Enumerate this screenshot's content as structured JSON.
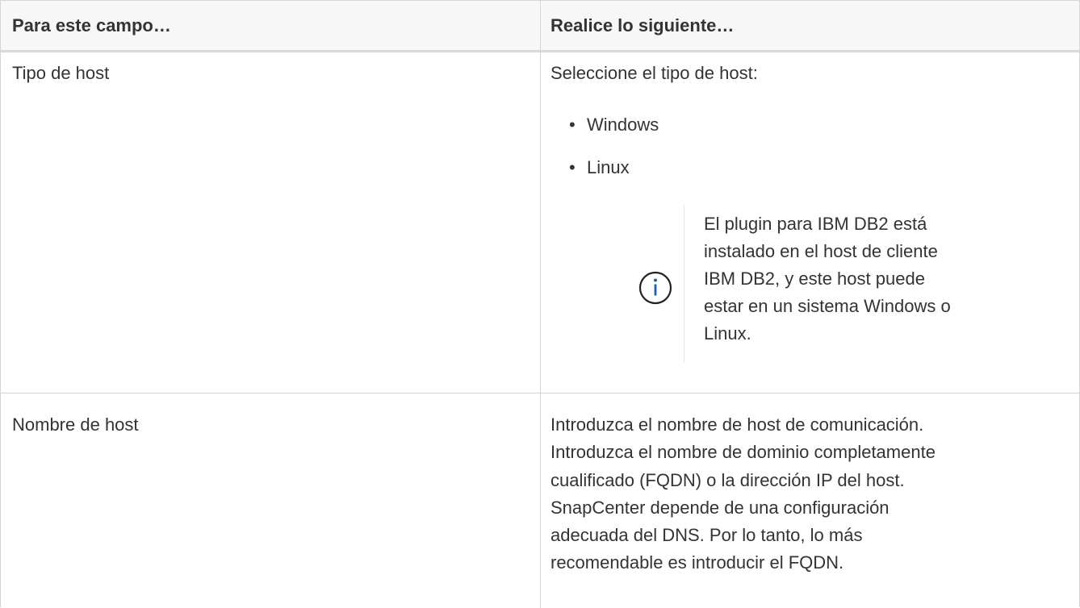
{
  "table": {
    "headers": {
      "field": "Para este campo…",
      "action": "Realice lo siguiente…"
    },
    "rows": [
      {
        "field": "Tipo de host",
        "intro": "Seleccione el tipo de host:",
        "options": [
          "Windows",
          "Linux"
        ],
        "note": {
          "icon": "info-icon",
          "lines": [
            "El plugin para IBM DB2 está",
            "instalado en el host de cliente",
            "IBM DB2, y este host puede",
            "estar en un sistema Windows o",
            "Linux."
          ]
        }
      },
      {
        "field": "Nombre de host",
        "lines": [
          "Introduzca el nombre de host de comunicación.",
          "Introduzca el nombre de dominio completamente",
          "cualificado (FQDN) o la dirección IP del host.",
          "SnapCenter depende de una configuración",
          "adecuada del DNS. Por lo tanto, lo más",
          "recomendable es introducir el FQDN."
        ]
      }
    ]
  },
  "colors": {
    "text": "#333333",
    "border": "#d5d5d5",
    "header_bg": "#f7f7f7",
    "info_icon": "#1f5ea8"
  }
}
